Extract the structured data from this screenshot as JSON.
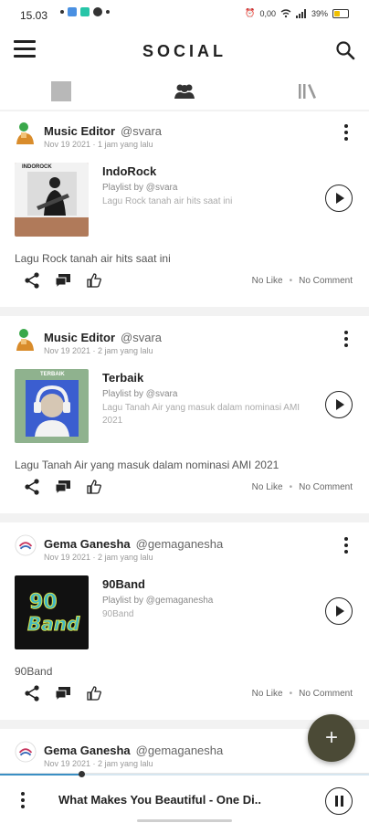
{
  "status_bar": {
    "time": "15.03",
    "right_text": "0,00",
    "battery_text": "39%",
    "battery_level": 0.39,
    "colors": {
      "app1": "#4a90e2",
      "app2": "#27c5a8",
      "battery": "#f0c000"
    }
  },
  "app_bar": {
    "title": "SOCIAL"
  },
  "tabs": [
    {
      "icon": "grid-square-icon"
    },
    {
      "icon": "people-icon",
      "selected": true
    },
    {
      "icon": "library-icon"
    }
  ],
  "posts": [
    {
      "user": "Music Editor",
      "handle": "@svara",
      "date": "Nov 19 2021 · 1 jam yang lalu",
      "playlist_title": "IndoRock",
      "playlist_by": "Playlist by @svara",
      "playlist_desc": "Lagu Rock tanah air hits saat ini",
      "cover_label": "INDOROCK",
      "caption": "Lagu Rock tanah air hits saat ini",
      "likes": "No Like",
      "comments": "No Comment"
    },
    {
      "user": "Music Editor",
      "handle": "@svara",
      "date": "Nov 19 2021 · 2 jam yang lalu",
      "playlist_title": "Terbaik",
      "playlist_by": "Playlist by @svara",
      "playlist_desc": "Lagu Tanah Air yang masuk dalam nominasi AMI 2021",
      "cover_label": "TERBAIK",
      "caption": "Lagu Tanah Air yang masuk dalam nominasi AMI 2021",
      "likes": "No Like",
      "comments": "No Comment"
    },
    {
      "user": "Gema Ganesha",
      "handle": "@gemaganesha",
      "date": "Nov 19 2021 · 2 jam yang lalu",
      "playlist_title": "90Band",
      "playlist_by": "Playlist by @gemaganesha",
      "playlist_desc": "90Band",
      "caption": "90Band",
      "likes": "No Like",
      "comments": "No Comment"
    },
    {
      "user": "Gema Ganesha",
      "handle": "@gemaganesha",
      "date": "Nov 19 2021 · 2 jam yang lalu"
    }
  ],
  "fab": {
    "label": "+"
  },
  "player": {
    "title": "What Makes You Beautiful - One Di..",
    "progress": 0.22
  }
}
